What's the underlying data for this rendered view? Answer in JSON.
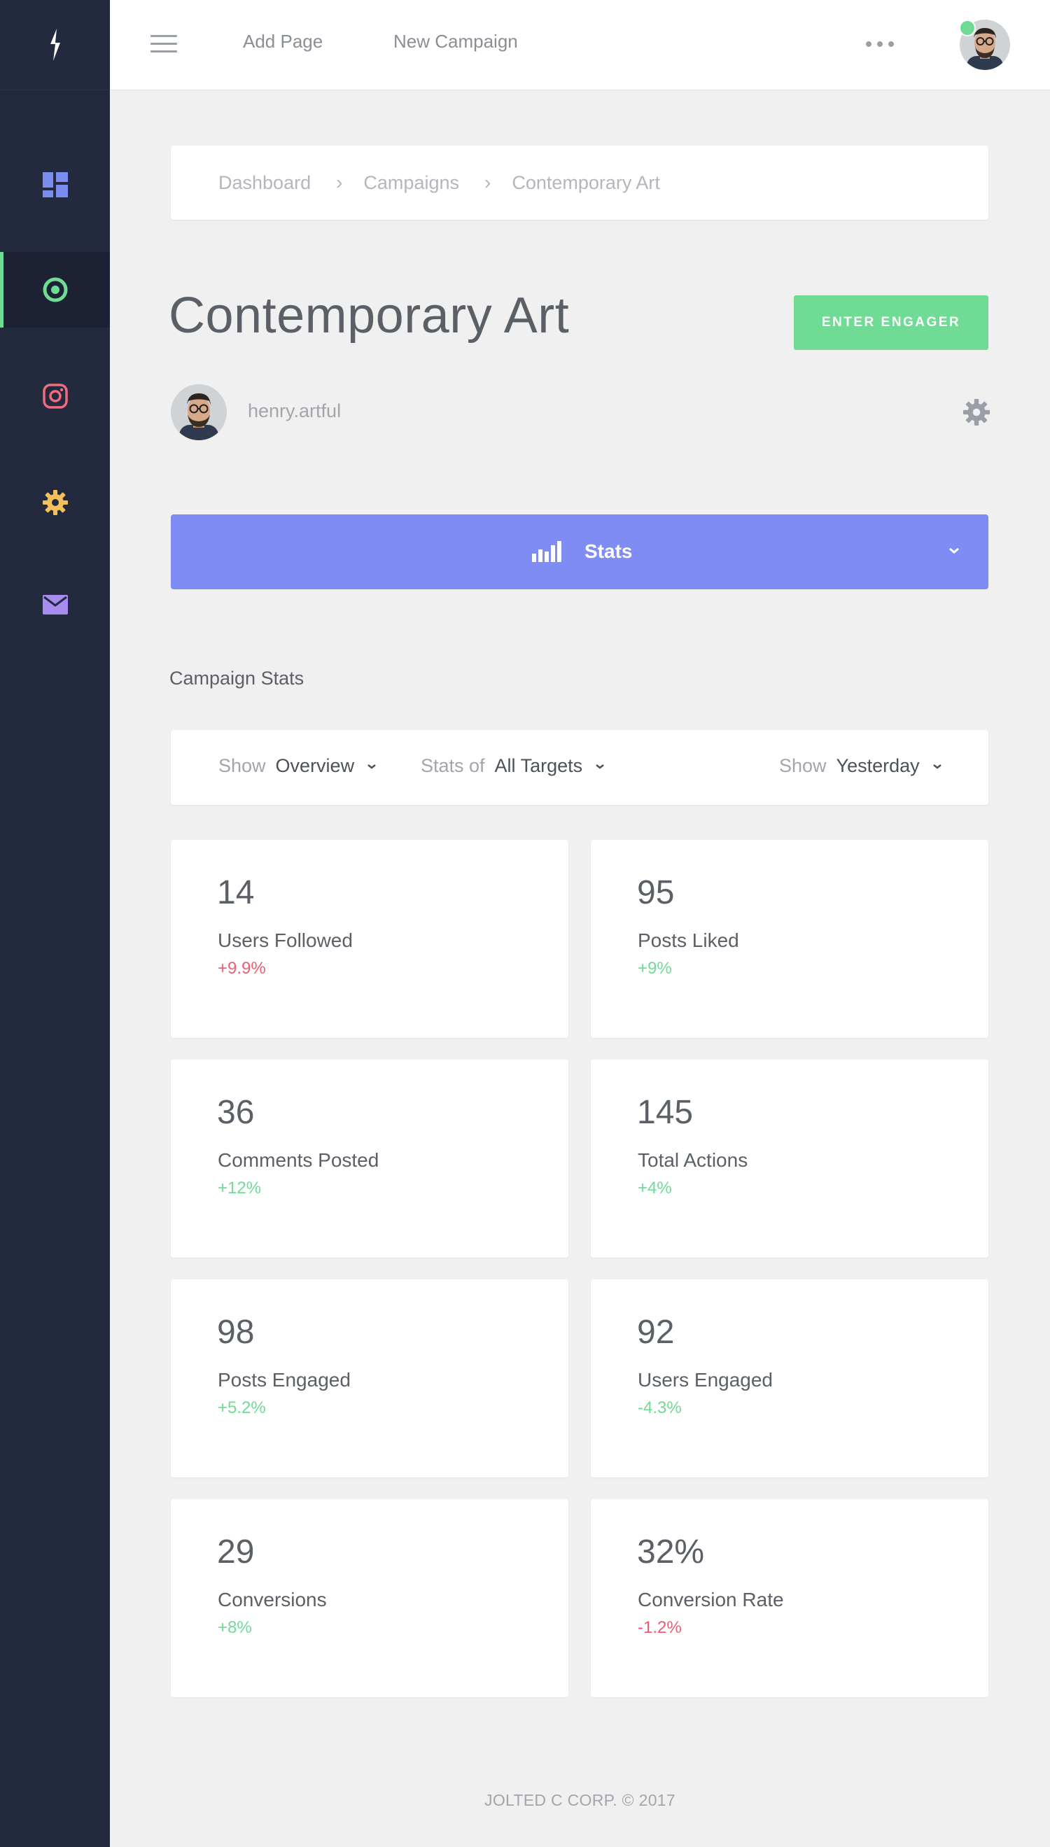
{
  "topbar": {
    "links": [
      "Add Page",
      "New Campaign"
    ]
  },
  "sidebar": {
    "items": [
      {
        "icon": "dashboard-icon",
        "color": "#7b8cf0"
      },
      {
        "icon": "target-icon",
        "color": "#6fdb95",
        "active": true
      },
      {
        "icon": "instagram-icon",
        "color": "#f06a80"
      },
      {
        "icon": "gear-icon",
        "color": "#f4c05a"
      },
      {
        "icon": "mail-icon",
        "color": "#a88cf0"
      }
    ]
  },
  "breadcrumb": {
    "items": [
      "Dashboard",
      "Campaigns",
      "Contemporary Art"
    ],
    "separator": "›"
  },
  "page": {
    "title": "Contemporary Art",
    "cta_label": "ENTER ENGAGER",
    "username": "henry.artful"
  },
  "stats_bar": {
    "label": "Stats"
  },
  "section_title": "Campaign Stats",
  "filters": [
    {
      "label": "Show",
      "value": "Overview"
    },
    {
      "label": "Stats of",
      "value": "All Targets"
    },
    {
      "label": "Show",
      "value": "Yesterday"
    }
  ],
  "stats": [
    {
      "value": "14",
      "label": "Users Followed",
      "change": "+9.9%",
      "trend": "negative"
    },
    {
      "value": "95",
      "label": "Posts Liked",
      "change": "+9%",
      "trend": "positive"
    },
    {
      "value": "36",
      "label": "Comments Posted",
      "change": "+12%",
      "trend": "positive"
    },
    {
      "value": "145",
      "label": "Total Actions",
      "change": "+4%",
      "trend": "positive"
    },
    {
      "value": "98",
      "label": "Posts Engaged",
      "change": "+5.2%",
      "trend": "positive"
    },
    {
      "value": "92",
      "label": "Users Engaged",
      "change": "-4.3%",
      "trend": "positive"
    },
    {
      "value": "29",
      "label": "Conversions",
      "change": "+8%",
      "trend": "positive"
    },
    {
      "value": "32%",
      "label": "Conversion Rate",
      "change": "-1.2%",
      "trend": "negative"
    }
  ],
  "colors": {
    "positive": "#6fdb95",
    "negative": "#f05c72",
    "accent": "#7f8cf4",
    "sidebar": "#232a3d"
  },
  "footer": "JOLTED C CORP. © 2017"
}
